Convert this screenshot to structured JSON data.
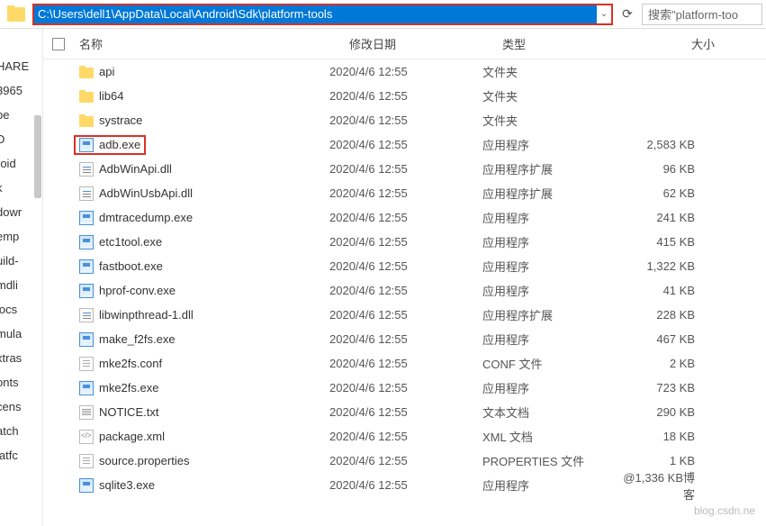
{
  "toolbar": {
    "address_path": "C:\\Users\\dell1\\AppData\\Local\\Android\\Sdk\\platform-tools",
    "search_placeholder": "搜索\"platform-too"
  },
  "columns": {
    "name": "名称",
    "date": "修改日期",
    "type": "类型",
    "size": "大小"
  },
  "sidebar_items": [
    "HARE",
    "3965",
    "be",
    "D",
    "roid",
    "k",
    "dowr",
    "emp",
    "uild-",
    "mdli",
    "locs",
    "mula",
    "xtras",
    "onts",
    "cens",
    "atch",
    "latfc"
  ],
  "files": [
    {
      "icon": "folder",
      "name": "api",
      "date": "2020/4/6 12:55",
      "type": "文件夹",
      "size": "",
      "hl": false
    },
    {
      "icon": "folder",
      "name": "lib64",
      "date": "2020/4/6 12:55",
      "type": "文件夹",
      "size": "",
      "hl": false
    },
    {
      "icon": "folder",
      "name": "systrace",
      "date": "2020/4/6 12:55",
      "type": "文件夹",
      "size": "",
      "hl": false
    },
    {
      "icon": "exe",
      "name": "adb.exe",
      "date": "2020/4/6 12:55",
      "type": "应用程序",
      "size": "2,583 KB",
      "hl": true
    },
    {
      "icon": "dll",
      "name": "AdbWinApi.dll",
      "date": "2020/4/6 12:55",
      "type": "应用程序扩展",
      "size": "96 KB",
      "hl": false
    },
    {
      "icon": "dll",
      "name": "AdbWinUsbApi.dll",
      "date": "2020/4/6 12:55",
      "type": "应用程序扩展",
      "size": "62 KB",
      "hl": false
    },
    {
      "icon": "exe",
      "name": "dmtracedump.exe",
      "date": "2020/4/6 12:55",
      "type": "应用程序",
      "size": "241 KB",
      "hl": false
    },
    {
      "icon": "exe",
      "name": "etc1tool.exe",
      "date": "2020/4/6 12:55",
      "type": "应用程序",
      "size": "415 KB",
      "hl": false
    },
    {
      "icon": "exe",
      "name": "fastboot.exe",
      "date": "2020/4/6 12:55",
      "type": "应用程序",
      "size": "1,322 KB",
      "hl": false
    },
    {
      "icon": "exe",
      "name": "hprof-conv.exe",
      "date": "2020/4/6 12:55",
      "type": "应用程序",
      "size": "41 KB",
      "hl": false
    },
    {
      "icon": "dll",
      "name": "libwinpthread-1.dll",
      "date": "2020/4/6 12:55",
      "type": "应用程序扩展",
      "size": "228 KB",
      "hl": false
    },
    {
      "icon": "exe",
      "name": "make_f2fs.exe",
      "date": "2020/4/6 12:55",
      "type": "应用程序",
      "size": "467 KB",
      "hl": false
    },
    {
      "icon": "file",
      "name": "mke2fs.conf",
      "date": "2020/4/6 12:55",
      "type": "CONF 文件",
      "size": "2 KB",
      "hl": false
    },
    {
      "icon": "exe",
      "name": "mke2fs.exe",
      "date": "2020/4/6 12:55",
      "type": "应用程序",
      "size": "723 KB",
      "hl": false
    },
    {
      "icon": "txt",
      "name": "NOTICE.txt",
      "date": "2020/4/6 12:55",
      "type": "文本文档",
      "size": "290 KB",
      "hl": false
    },
    {
      "icon": "xml",
      "name": "package.xml",
      "date": "2020/4/6 12:55",
      "type": "XML 文档",
      "size": "18 KB",
      "hl": false
    },
    {
      "icon": "file",
      "name": "source.properties",
      "date": "2020/4/6 12:55",
      "type": "PROPERTIES 文件",
      "size": "1 KB",
      "hl": false
    },
    {
      "icon": "exe",
      "name": "sqlite3.exe",
      "date": "2020/4/6 12:55",
      "type": "应用程序",
      "size": "@1,336 KB博客",
      "hl": false
    }
  ],
  "watermark": "blog.csdn.ne"
}
